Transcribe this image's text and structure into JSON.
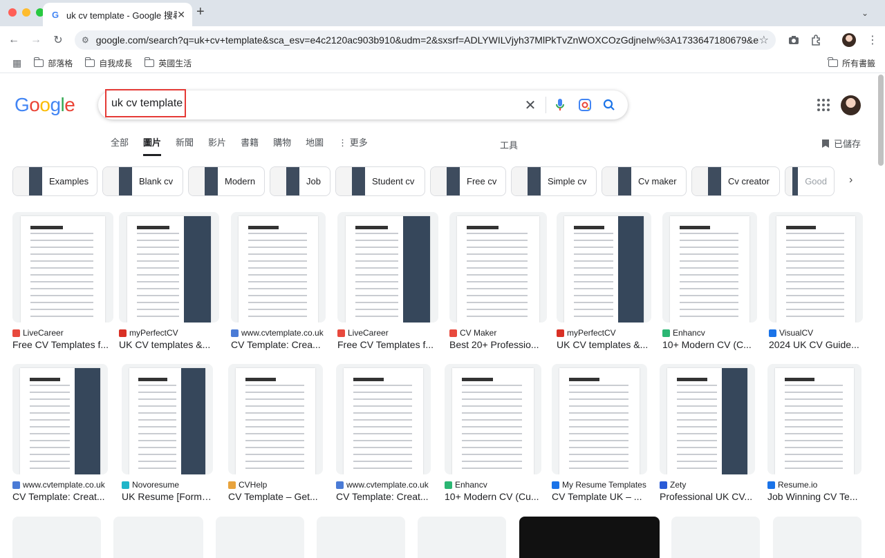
{
  "browser": {
    "tab_title": "uk cv template - Google 搜尋",
    "url": "google.com/search?q=uk+cv+template&sca_esv=e4c2120ac903b910&udm=2&sxsrf=ADLYWILVjyh37MlPkTvZnWOXCOzGdjneIw%3A1733647180679&ei=TFtV...",
    "bookmarks": [
      "部落格",
      "自我成長",
      "英國生活"
    ],
    "all_bookmarks": "所有書籤"
  },
  "search": {
    "logo": "Google",
    "query": "uk cv template"
  },
  "nav": {
    "tabs": [
      "全部",
      "圖片",
      "新聞",
      "影片",
      "書籍",
      "購物",
      "地圖",
      "更多"
    ],
    "active": "圖片",
    "tools": "工具",
    "saved": "已儲存"
  },
  "chips": [
    "Examples",
    "Blank cv",
    "Modern",
    "Job",
    "Student cv",
    "Free cv",
    "Simple cv",
    "Cv maker",
    "Cv creator",
    "Good"
  ],
  "results_row1": [
    {
      "source": "LiveCareer",
      "title": "Free CV Templates f...",
      "fav": "#e8493d"
    },
    {
      "source": "myPerfectCV",
      "title": "UK CV templates &...",
      "fav": "#d93025"
    },
    {
      "source": "www.cvtemplate.co.uk",
      "title": "CV Template: Crea...",
      "fav": "#4a7bd6"
    },
    {
      "source": "LiveCareer",
      "title": "Free CV Templates f...",
      "fav": "#e8493d"
    },
    {
      "source": "CV Maker",
      "title": "Best 20+ Professio...",
      "fav": "#e8493d"
    },
    {
      "source": "myPerfectCV",
      "title": "UK CV templates &...",
      "fav": "#d93025"
    },
    {
      "source": "Enhancv",
      "title": "10+ Modern CV (C...",
      "fav": "#2bb673"
    },
    {
      "source": "VisualCV",
      "title": "2024 UK CV Guide...",
      "fav": "#1a73e8"
    }
  ],
  "results_row2": [
    {
      "source": "www.cvtemplate.co.uk",
      "title": "CV Template: Creat...",
      "fav": "#4a7bd6"
    },
    {
      "source": "Novoresume",
      "title": "UK Resume [Forma...",
      "fav": "#1fb5c9"
    },
    {
      "source": "CVHelp",
      "title": "CV Template – Get...",
      "fav": "#e8a33d"
    },
    {
      "source": "www.cvtemplate.co.uk",
      "title": "CV Template: Creat...",
      "fav": "#4a7bd6"
    },
    {
      "source": "Enhancv",
      "title": "10+ Modern CV (Cu...",
      "fav": "#2bb673"
    },
    {
      "source": "My Resume Templates",
      "title": "CV Template UK – ...",
      "fav": "#1a73e8"
    },
    {
      "source": "Zety",
      "title": "Professional UK CV...",
      "fav": "#2a5bd7"
    },
    {
      "source": "Resume.io",
      "title": "Job Winning CV Te...",
      "fav": "#1a73e8"
    }
  ],
  "colors": {
    "accent": "#1a73e8",
    "highlight_border": "#e53935"
  }
}
